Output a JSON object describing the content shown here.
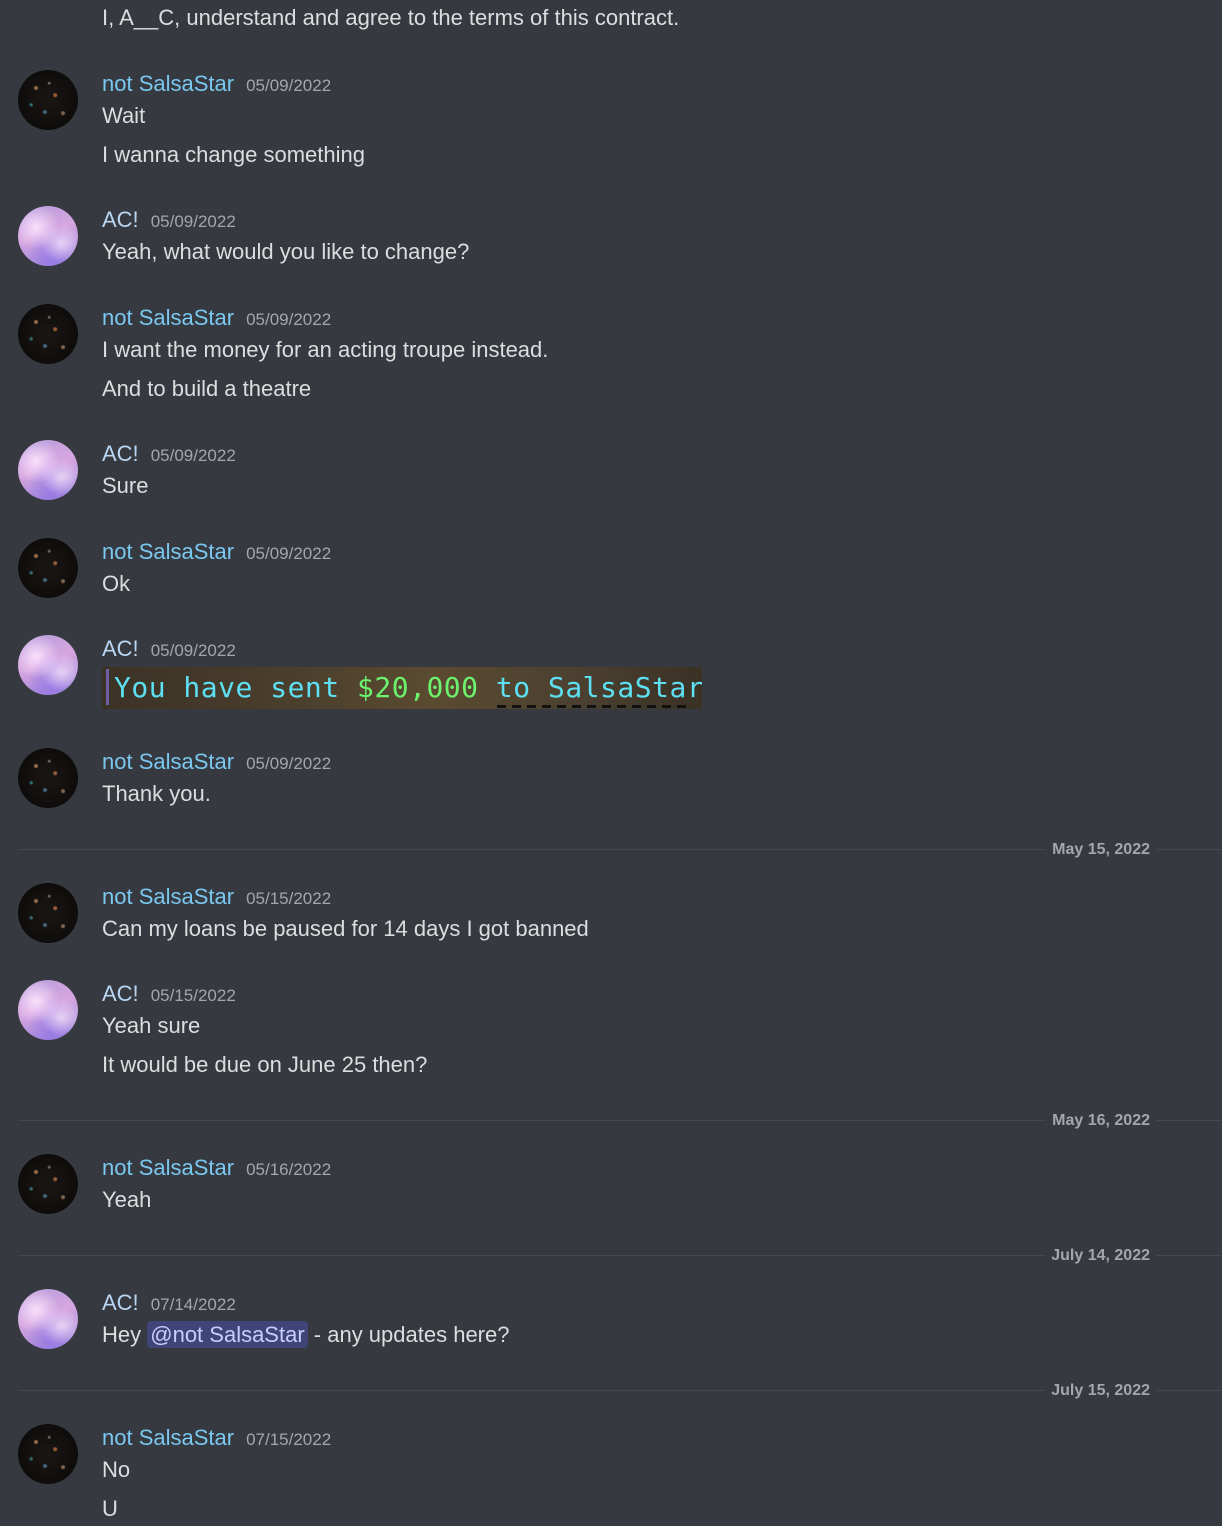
{
  "intro_line": "I, A__C, understand and agree to the terms of this contract.",
  "users": {
    "salsa": "not SalsaStar",
    "ac": "AC!"
  },
  "messages": [
    {
      "user": "not SalsaStar",
      "time": "05/09/2022",
      "lines": [
        "Wait",
        "I wanna change something"
      ]
    },
    {
      "user": "AC!",
      "time": "05/09/2022",
      "lines": [
        "Yeah, what would you like to change?"
      ]
    },
    {
      "user": "not SalsaStar",
      "time": "05/09/2022",
      "lines": [
        "I want the money for an acting troupe instead.",
        "And to build a theatre"
      ]
    },
    {
      "user": "AC!",
      "time": "05/09/2022",
      "lines": [
        "Sure"
      ]
    },
    {
      "user": "not SalsaStar",
      "time": "05/09/2022",
      "lines": [
        "Ok"
      ]
    },
    {
      "user": "AC!",
      "time": "05/09/2022",
      "image": {
        "part1": "You have sent ",
        "amount": "$20,000",
        "part2": " to SalsaStar."
      }
    },
    {
      "user": "not SalsaStar",
      "time": "05/09/2022",
      "lines": [
        "Thank you."
      ]
    },
    {
      "user": "not SalsaStar",
      "time": "05/15/2022",
      "lines": [
        "Can my loans be paused for 14 days I got banned"
      ]
    },
    {
      "user": "AC!",
      "time": "05/15/2022",
      "lines": [
        "Yeah sure",
        "It would be due on June 25 then?"
      ]
    },
    {
      "user": "not SalsaStar",
      "time": "05/16/2022",
      "lines": [
        "Yeah"
      ]
    },
    {
      "user": "AC!",
      "time": "07/14/2022",
      "mention_line": {
        "before": "Hey ",
        "mention": "@not SalsaStar",
        "after": " - any updates here?"
      }
    },
    {
      "user": "not SalsaStar",
      "time": "07/15/2022",
      "lines": [
        "No",
        "U"
      ]
    }
  ],
  "dividers": [
    "May 15, 2022",
    "May 16, 2022",
    "July 14, 2022",
    "July 15, 2022"
  ],
  "colors": {
    "background": "#36393f",
    "salsa_name": "#7ac8f0",
    "ac_name": "#b9d7f4",
    "mention_bg": "#3f4578"
  }
}
